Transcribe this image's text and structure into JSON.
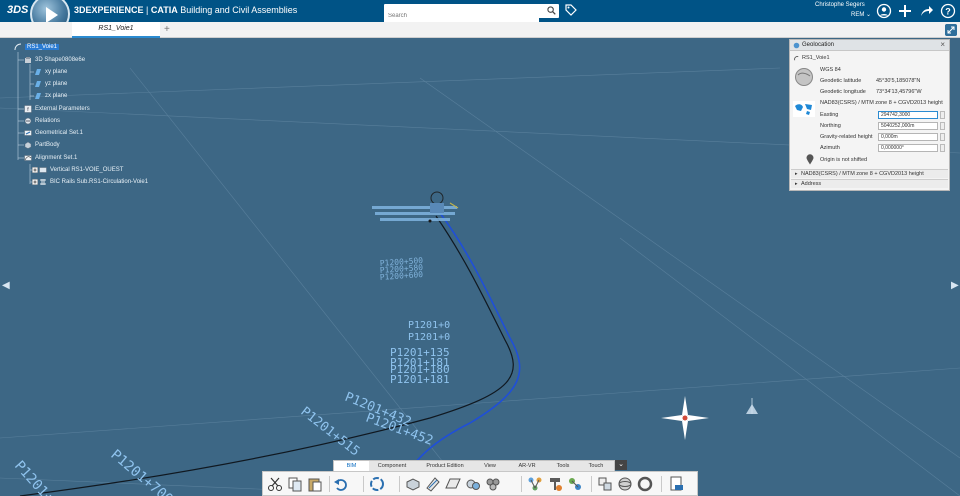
{
  "header": {
    "brand_logo": "3DS",
    "product_title_1": "3DEXPERIENCE",
    "product_title_sep": " | ",
    "product_title_2": "CATIA",
    "product_title_3": " Building and Civil Assemblies",
    "search_placeholder": "Search",
    "user_name": "Christophe Segers",
    "user_role": "REM ⌄"
  },
  "tabs": [
    {
      "label": "RS1_Voie1"
    }
  ],
  "tree": {
    "root": "RS1_Voie1",
    "items": [
      "3D Shape0808e6e",
      "xy plane",
      "yz plane",
      "zx plane",
      "External Parameters",
      "Relations",
      "Geometrical Set.1",
      "PartBody",
      "Alignment Set.1",
      "Vertical RS1-VOIE_OUEST",
      "BIC Rails Sub.RS1-Circulation-Voie1"
    ]
  },
  "geolocation": {
    "title": "Geolocation",
    "object": "RS1_Voie1",
    "datum": "WGS 84",
    "lat_label": "Geodetic latitude",
    "lat_value": "45°30'5,185078\"N",
    "lon_label": "Geodetic longitude",
    "lon_value": "73°34'13,45796\"W",
    "crs": "NAD83(CSRS) / MTM zone 8 + CGVD2013 height",
    "easting_label": "Easting",
    "easting_value": "294742,3000",
    "northing_label": "Northing",
    "northing_value": "5040252,000m",
    "gravity_label": "Gravity-related height",
    "gravity_value": "0,000m",
    "azimuth_label": "Azimuth",
    "azimuth_value": "0,000000°",
    "origin_status": "Origin is not shifted",
    "section_crs": "NAD83(CSRS) / MTM zone 8 + CGVD2013 height",
    "section_address": "Address"
  },
  "viewport_labels": [
    "P1200+500",
    "P1200+580",
    "P1200+600",
    "P1201+0",
    "P1201+0",
    "P1201+135",
    "P1201+181",
    "P1201+180",
    "P1201+181",
    "P1201+432",
    "P1201+515",
    "P1201+452",
    "P1201+700",
    "P1201+"
  ],
  "bottom_tabs": [
    "BIM",
    "Component",
    "Product Edition",
    "View",
    "AR-VR",
    "Tools",
    "Touch"
  ],
  "colors": {
    "top_bar": "#005386",
    "viewport": "#3d6785",
    "accent": "#2b8bd1",
    "alignment_blue": "#1f4fd8",
    "alignment_black": "#101820"
  }
}
